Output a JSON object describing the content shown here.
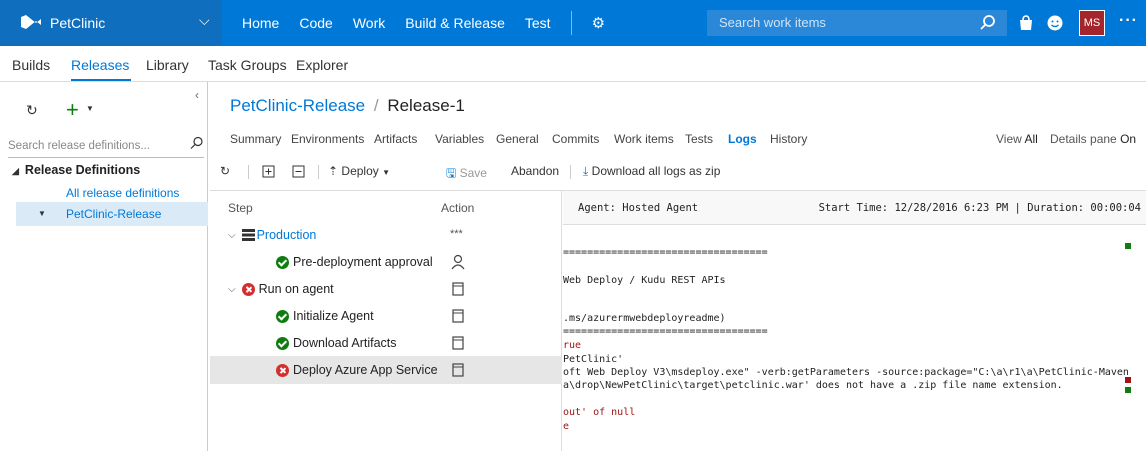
{
  "topbar": {
    "project": "PetClinic",
    "nav": [
      "Home",
      "Code",
      "Work",
      "Build & Release",
      "Test"
    ],
    "search_placeholder": "Search work items",
    "avatar_initials": "MS",
    "more": "···",
    "colors": {
      "bar": "#0078d7",
      "project_bg": "#106ebe",
      "avatar": "#a4262c"
    }
  },
  "subnav": {
    "items": [
      "Builds",
      "Releases",
      "Library",
      "Task Groups",
      "Explorer"
    ],
    "active": "Releases"
  },
  "left": {
    "search_placeholder": "Search release definitions...",
    "heading": "Release Definitions",
    "all_label": "All release definitions",
    "selected": "PetClinic-Release"
  },
  "breadcrumb": {
    "definition": "PetClinic-Release",
    "separator": "/",
    "release": "Release-1"
  },
  "tabs": {
    "items": [
      "Summary",
      "Environments",
      "Artifacts",
      "Variables",
      "General",
      "Commits",
      "Work items",
      "Tests",
      "Logs",
      "History"
    ],
    "active": "Logs",
    "view_label": "View",
    "view_value": "All",
    "pane_label": "Details pane",
    "pane_value": "On"
  },
  "toolbar": {
    "deploy": "Deploy",
    "save": "Save",
    "abandon": "Abandon",
    "download": "Download all logs as zip"
  },
  "steps": {
    "col_step": "Step",
    "col_action": "Action",
    "rows": [
      {
        "label": "Production",
        "status": "env",
        "action_icon": "more-icon",
        "action_text": "***"
      },
      {
        "label": "Pre-deployment approval",
        "status": "ok",
        "action_icon": "person-icon"
      },
      {
        "label": "Run on agent",
        "status": "error",
        "action_icon": "log-icon"
      },
      {
        "label": "Initialize Agent",
        "status": "ok",
        "action_icon": "log-icon"
      },
      {
        "label": "Download Artifacts",
        "status": "ok",
        "action_icon": "log-icon"
      },
      {
        "label": "Deploy Azure App Service",
        "status": "error",
        "action_icon": "log-icon",
        "selected": true
      }
    ]
  },
  "log": {
    "agent": "Agent: Hosted Agent",
    "stats": "Start Time: 12/28/2016 6:23 PM | Duration: 00:00:04",
    "lines": [
      {
        "text": "==================================",
        "color": "normal"
      },
      {
        "text": "Web Deploy / Kudu REST APIs",
        "color": "normal"
      },
      {
        "text": ".ms/azurermwebdeployreadme)",
        "color": "normal"
      },
      {
        "text": "==================================",
        "color": "normal"
      },
      {
        "text": "rue",
        "color": "red"
      },
      {
        "text": "PetClinic'",
        "color": "normal"
      },
      {
        "text": "oft Web Deploy V3\\msdeploy.exe\" -verb:getParameters -source:package=\"C:\\a\\r1\\a\\PetClinic-Maven",
        "color": "normal"
      },
      {
        "text": "a\\drop\\NewPetClinic\\target\\petclinic.war' does not have a .zip file name extension.",
        "color": "normal"
      },
      {
        "text": "out' of null",
        "color": "red"
      },
      {
        "text": "e",
        "color": "red"
      }
    ]
  }
}
